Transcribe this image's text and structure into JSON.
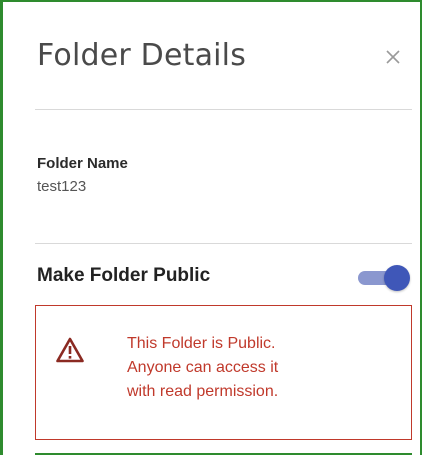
{
  "panel": {
    "title": "Folder Details",
    "close_icon": "close-icon"
  },
  "folder": {
    "name_label": "Folder Name",
    "name_value": "test123"
  },
  "visibility": {
    "label": "Make Folder Public",
    "enabled": true
  },
  "alert": {
    "icon": "warning-icon",
    "lines": [
      "This Folder is Public.",
      "Anyone can access it",
      "with read permission."
    ],
    "color": "#c0392b"
  },
  "colors": {
    "toggle_knob": "#3f57b8",
    "toggle_track": "#8a97cf",
    "frame": "#2e8b2e"
  }
}
